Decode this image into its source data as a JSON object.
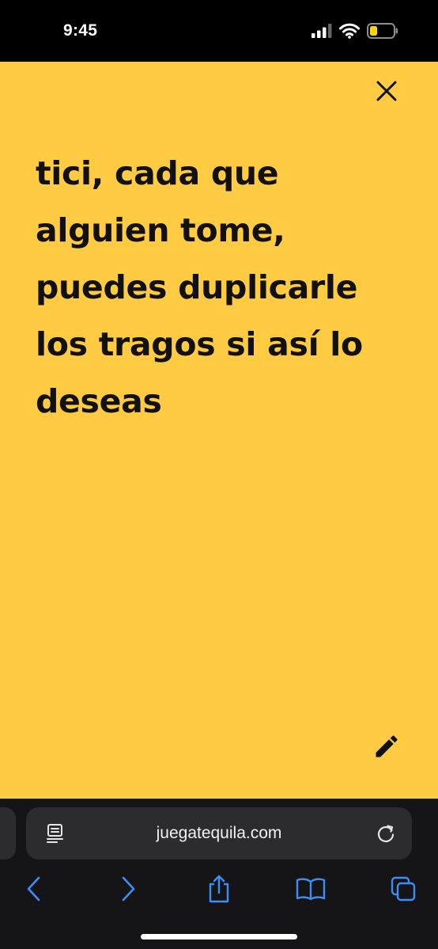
{
  "status_bar": {
    "time": "9:45",
    "icons": [
      "cellular-signal-icon",
      "wifi-icon",
      "battery-low-icon"
    ],
    "battery_color": "#ffd60a"
  },
  "card": {
    "background_color": "#fecb42",
    "text": "tici, cada que alguien tome, puedes duplicarle los tragos si así lo deseas",
    "close_icon": "close-icon",
    "edit_icon": "pencil-icon"
  },
  "browser": {
    "url": "juegatequila.com",
    "left_icon": "reader-view-icon",
    "right_icon": "reload-icon",
    "accent_color": "#3d8ef7",
    "toolbar": [
      "back-icon",
      "forward-icon",
      "share-icon",
      "bookmarks-icon",
      "tabs-icon"
    ]
  }
}
